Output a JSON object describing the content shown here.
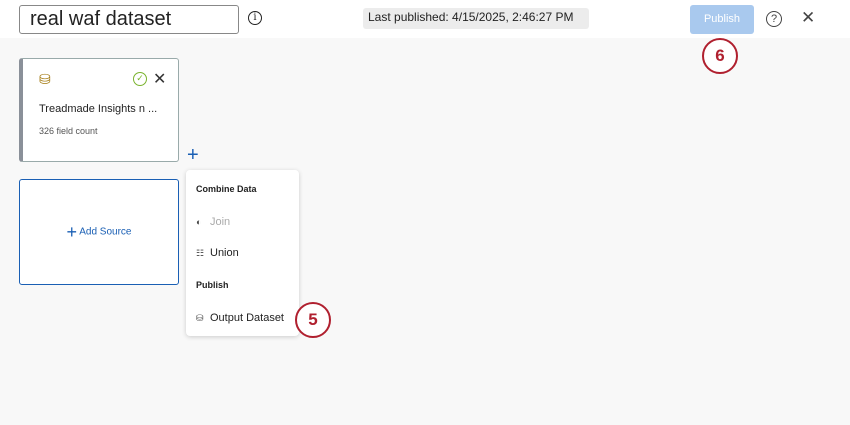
{
  "header": {
    "title": "real waf dataset",
    "last_published": "Last published: 4/15/2025, 2:46:27 PM",
    "publish_label": "Publish",
    "help": "?",
    "close": "✕"
  },
  "badges": {
    "publish_step": "6",
    "output_step": "5"
  },
  "source_card": {
    "name": "Treadmade Insights n ...",
    "field_count": "326 field count"
  },
  "add_source": {
    "label": "Add Source"
  },
  "menu": {
    "combine_heading": "Combine Data",
    "join": "Join",
    "union": "Union",
    "publish_heading": "Publish",
    "output_dataset": "Output Dataset"
  }
}
